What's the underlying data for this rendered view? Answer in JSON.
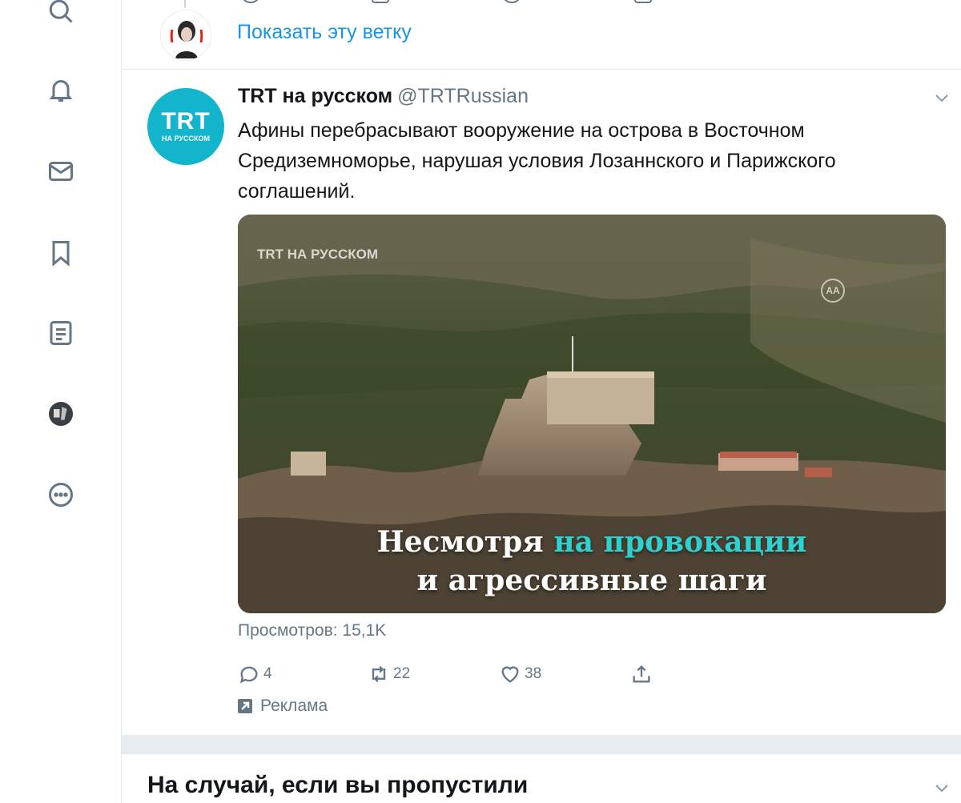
{
  "nav": {
    "items": [
      {
        "icon": "search-icon"
      },
      {
        "icon": "bell-icon"
      },
      {
        "icon": "mail-icon"
      },
      {
        "icon": "bookmark-icon"
      },
      {
        "icon": "list-icon"
      },
      {
        "icon": "profile-avatar"
      },
      {
        "icon": "more-icon"
      }
    ]
  },
  "thread": {
    "show_thread_label": "Показать эту ветку"
  },
  "tweet": {
    "avatar_text_big": "TRT",
    "avatar_text_small": "НА РУССКОМ",
    "author_name": "TRT на русском",
    "author_handle": "@TRTRussian",
    "text": "Афины перебрасывают вооружение на острова в Восточном Средиземноморье, нарушая условия Лозаннского и Парижского соглашений.",
    "media": {
      "watermark": "TRT НА РУССКОМ",
      "agency_mark": "AA",
      "caption_line1_plain": "Несмотря ",
      "caption_line1_highlight": "на провокации",
      "caption_line2": "и агрессивные шаги"
    },
    "views": "Просмотров: 15,1K",
    "actions": {
      "replies": "4",
      "retweets": "22",
      "likes": "38"
    },
    "promoted_label": "Реклама"
  },
  "section": {
    "title": "На случай, если вы пропустили"
  },
  "colors": {
    "accent": "#1b95e0",
    "muted": "#657786",
    "trt_brand": "#12b5cc",
    "caption_highlight": "#2fd1d0"
  }
}
